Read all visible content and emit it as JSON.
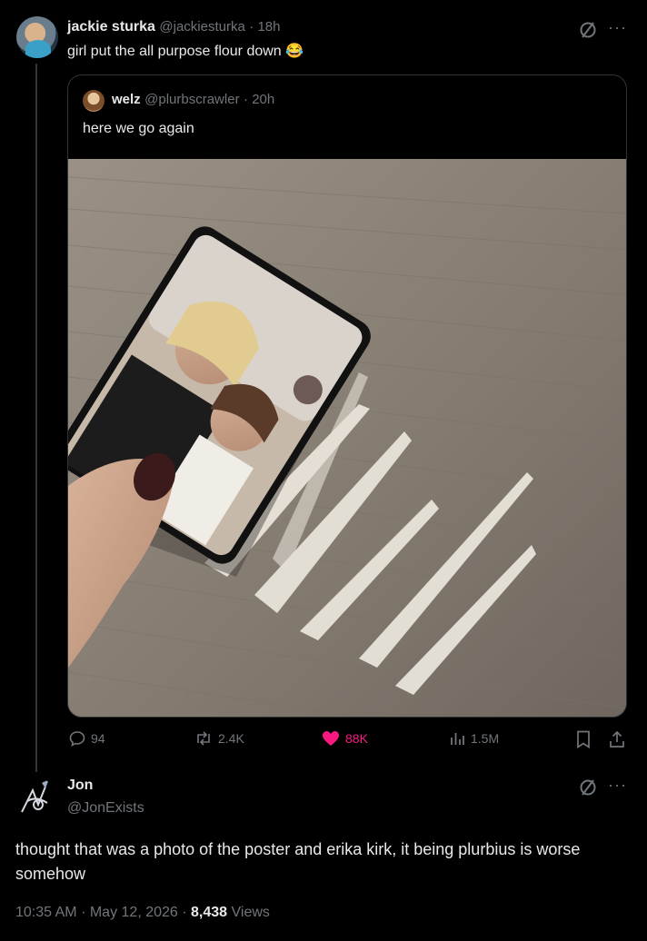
{
  "tweet1": {
    "display_name": "jackie sturka",
    "handle": "@jackiesturka",
    "time": "18h",
    "text": "girl put the all purpose flour down",
    "emoji": "😂"
  },
  "quote": {
    "display_name": "welz",
    "handle": "@plurbscrawler",
    "time": "20h",
    "text": "here we go again",
    "image_alt": "photo of two women held over lines of white powder on a wooden table"
  },
  "actions": {
    "replies": "94",
    "reposts": "2.4K",
    "likes": "88K",
    "views": "1.5M"
  },
  "reply": {
    "display_name": "Jon",
    "handle": "@JonExists",
    "text": "thought that was a photo of the poster and erika kirk, it being plurbius is worse somehow",
    "time": "10:35 AM",
    "date": "May 12, 2026",
    "views_count": "8,438",
    "views_label": "Views"
  },
  "colors": {
    "like_pink": "#f91880",
    "muted": "#71767b",
    "border": "#2f3336"
  },
  "icons": [
    "grok-icon",
    "more-icon",
    "reply-icon",
    "repost-icon",
    "heart-icon",
    "views-icon",
    "bookmark-icon",
    "share-icon"
  ]
}
